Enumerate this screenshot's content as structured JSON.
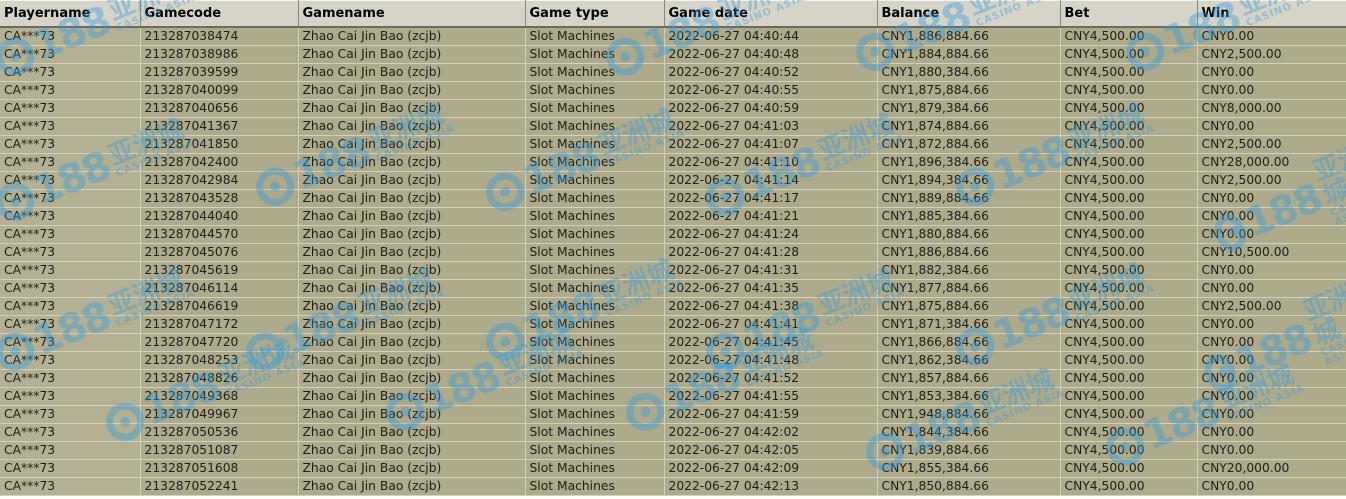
{
  "columns": [
    "Playername",
    "Gamecode",
    "Gamename",
    "Game type",
    "Game date",
    "Balance",
    "Bet",
    "Win"
  ],
  "rows": [
    [
      "CA***73",
      "213287038474",
      "Zhao Cai Jin Bao (zcjb)",
      "Slot Machines",
      "2022-06-27 04:40:44",
      "CNY1,886,884.66",
      "CNY4,500.00",
      "CNY0.00"
    ],
    [
      "CA***73",
      "213287038986",
      "Zhao Cai Jin Bao (zcjb)",
      "Slot Machines",
      "2022-06-27 04:40:48",
      "CNY1,884,884.66",
      "CNY4,500.00",
      "CNY2,500.00"
    ],
    [
      "CA***73",
      "213287039599",
      "Zhao Cai Jin Bao (zcjb)",
      "Slot Machines",
      "2022-06-27 04:40:52",
      "CNY1,880,384.66",
      "CNY4,500.00",
      "CNY0.00"
    ],
    [
      "CA***73",
      "213287040099",
      "Zhao Cai Jin Bao (zcjb)",
      "Slot Machines",
      "2022-06-27 04:40:55",
      "CNY1,875,884.66",
      "CNY4,500.00",
      "CNY0.00"
    ],
    [
      "CA***73",
      "213287040656",
      "Zhao Cai Jin Bao (zcjb)",
      "Slot Machines",
      "2022-06-27 04:40:59",
      "CNY1,879,384.66",
      "CNY4,500.00",
      "CNY8,000.00"
    ],
    [
      "CA***73",
      "213287041367",
      "Zhao Cai Jin Bao (zcjb)",
      "Slot Machines",
      "2022-06-27 04:41:03",
      "CNY1,874,884.66",
      "CNY4,500.00",
      "CNY0.00"
    ],
    [
      "CA***73",
      "213287041850",
      "Zhao Cai Jin Bao (zcjb)",
      "Slot Machines",
      "2022-06-27 04:41:07",
      "CNY1,872,884.66",
      "CNY4,500.00",
      "CNY2,500.00"
    ],
    [
      "CA***73",
      "213287042400",
      "Zhao Cai Jin Bao (zcjb)",
      "Slot Machines",
      "2022-06-27 04:41:10",
      "CNY1,896,384.66",
      "CNY4,500.00",
      "CNY28,000.00"
    ],
    [
      "CA***73",
      "213287042984",
      "Zhao Cai Jin Bao (zcjb)",
      "Slot Machines",
      "2022-06-27 04:41:14",
      "CNY1,894,384.66",
      "CNY4,500.00",
      "CNY2,500.00"
    ],
    [
      "CA***73",
      "213287043528",
      "Zhao Cai Jin Bao (zcjb)",
      "Slot Machines",
      "2022-06-27 04:41:17",
      "CNY1,889,884.66",
      "CNY4,500.00",
      "CNY0.00"
    ],
    [
      "CA***73",
      "213287044040",
      "Zhao Cai Jin Bao (zcjb)",
      "Slot Machines",
      "2022-06-27 04:41:21",
      "CNY1,885,384.66",
      "CNY4,500.00",
      "CNY0.00"
    ],
    [
      "CA***73",
      "213287044570",
      "Zhao Cai Jin Bao (zcjb)",
      "Slot Machines",
      "2022-06-27 04:41:24",
      "CNY1,880,884.66",
      "CNY4,500.00",
      "CNY0.00"
    ],
    [
      "CA***73",
      "213287045076",
      "Zhao Cai Jin Bao (zcjb)",
      "Slot Machines",
      "2022-06-27 04:41:28",
      "CNY1,886,884.66",
      "CNY4,500.00",
      "CNY10,500.00"
    ],
    [
      "CA***73",
      "213287045619",
      "Zhao Cai Jin Bao (zcjb)",
      "Slot Machines",
      "2022-06-27 04:41:31",
      "CNY1,882,384.66",
      "CNY4,500.00",
      "CNY0.00"
    ],
    [
      "CA***73",
      "213287046114",
      "Zhao Cai Jin Bao (zcjb)",
      "Slot Machines",
      "2022-06-27 04:41:35",
      "CNY1,877,884.66",
      "CNY4,500.00",
      "CNY0.00"
    ],
    [
      "CA***73",
      "213287046619",
      "Zhao Cai Jin Bao (zcjb)",
      "Slot Machines",
      "2022-06-27 04:41:38",
      "CNY1,875,884.66",
      "CNY4,500.00",
      "CNY2,500.00"
    ],
    [
      "CA***73",
      "213287047172",
      "Zhao Cai Jin Bao (zcjb)",
      "Slot Machines",
      "2022-06-27 04:41:41",
      "CNY1,871,384.66",
      "CNY4,500.00",
      "CNY0.00"
    ],
    [
      "CA***73",
      "213287047720",
      "Zhao Cai Jin Bao (zcjb)",
      "Slot Machines",
      "2022-06-27 04:41:45",
      "CNY1,866,884.66",
      "CNY4,500.00",
      "CNY0.00"
    ],
    [
      "CA***73",
      "213287048253",
      "Zhao Cai Jin Bao (zcjb)",
      "Slot Machines",
      "2022-06-27 04:41:48",
      "CNY1,862,384.66",
      "CNY4,500.00",
      "CNY0.00"
    ],
    [
      "CA***73",
      "213287048826",
      "Zhao Cai Jin Bao (zcjb)",
      "Slot Machines",
      "2022-06-27 04:41:52",
      "CNY1,857,884.66",
      "CNY4,500.00",
      "CNY0.00"
    ],
    [
      "CA***73",
      "213287049368",
      "Zhao Cai Jin Bao (zcjb)",
      "Slot Machines",
      "2022-06-27 04:41:55",
      "CNY1,853,384.66",
      "CNY4,500.00",
      "CNY0.00"
    ],
    [
      "CA***73",
      "213287049967",
      "Zhao Cai Jin Bao (zcjb)",
      "Slot Machines",
      "2022-06-27 04:41:59",
      "CNY1,948,884.66",
      "CNY4,500.00",
      "CNY0.00"
    ],
    [
      "CA***73",
      "213287050536",
      "Zhao Cai Jin Bao (zcjb)",
      "Slot Machines",
      "2022-06-27 04:42:02",
      "CNY1,844,384.66",
      "CNY4,500.00",
      "CNY0.00"
    ],
    [
      "CA***73",
      "213287051087",
      "Zhao Cai Jin Bao (zcjb)",
      "Slot Machines",
      "2022-06-27 04:42:05",
      "CNY1,839,884.66",
      "CNY4,500.00",
      "CNY0.00"
    ],
    [
      "CA***73",
      "213287051608",
      "Zhao Cai Jin Bao (zcjb)",
      "Slot Machines",
      "2022-06-27 04:42:09",
      "CNY1,855,384.66",
      "CNY4,500.00",
      "CNY20,000.00"
    ],
    [
      "CA***73",
      "213287052241",
      "Zhao Cai Jin Bao (zcjb)",
      "Slot Machines",
      "2022-06-27 04:42:13",
      "CNY1,850,884.66",
      "CNY4,500.00",
      "CNY0.00"
    ]
  ],
  "watermark": {
    "number": "188",
    "brand_cn": "亚洲城",
    "brand_en": "CASINO ASIA",
    "color": "#2e9ce0"
  },
  "colors": {
    "header_bg": "#d6d3c9",
    "row_bg": "#aeaa8c",
    "text": "#1e1e18"
  }
}
